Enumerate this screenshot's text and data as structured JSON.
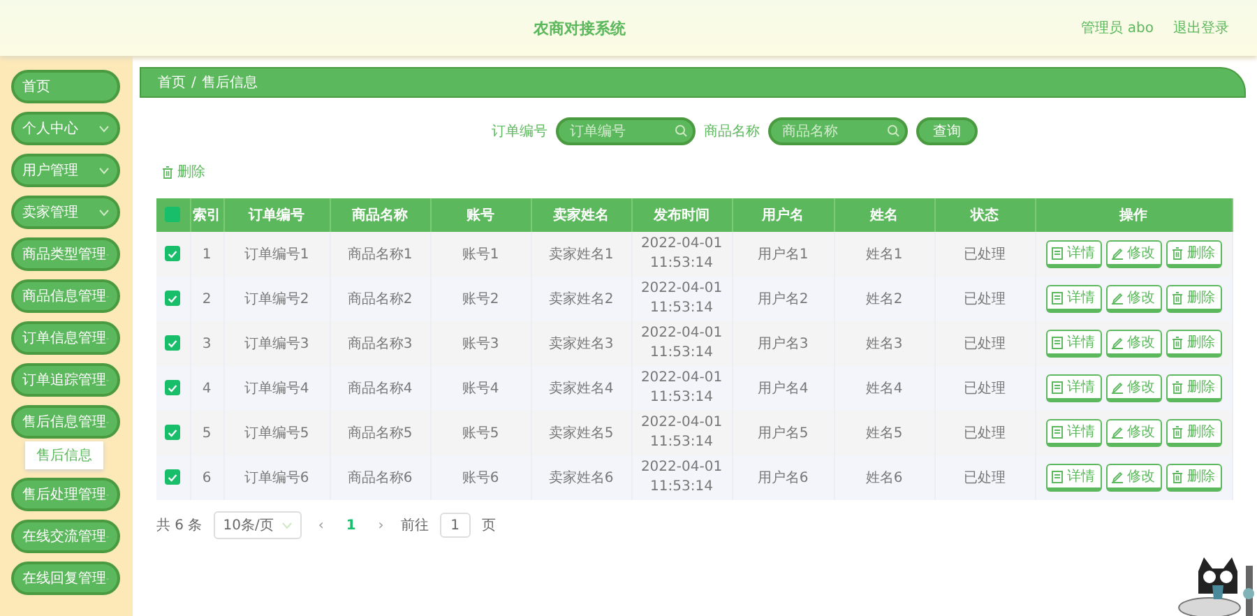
{
  "header": {
    "title": "农商对接系统",
    "user": "管理员 abo",
    "logout": "退出登录"
  },
  "sidebar": {
    "items": [
      {
        "label": "首页",
        "expandable": false
      },
      {
        "label": "个人中心",
        "expandable": true,
        "expanded": false
      },
      {
        "label": "用户管理",
        "expandable": true,
        "expanded": false
      },
      {
        "label": "卖家管理",
        "expandable": true,
        "expanded": false
      },
      {
        "label": "商品类型管理",
        "expandable": true,
        "expanded": false
      },
      {
        "label": "商品信息管理",
        "expandable": true,
        "expanded": false
      },
      {
        "label": "订单信息管理",
        "expandable": true,
        "expanded": false
      },
      {
        "label": "订单追踪管理",
        "expandable": true,
        "expanded": false
      },
      {
        "label": "售后信息管理",
        "expandable": true,
        "expanded": true,
        "children": [
          {
            "label": "售后信息"
          }
        ]
      },
      {
        "label": "售后处理管理",
        "expandable": true,
        "expanded": false
      },
      {
        "label": "在线交流管理",
        "expandable": true,
        "expanded": false
      },
      {
        "label": "在线回复管理",
        "expandable": true,
        "expanded": false
      }
    ]
  },
  "breadcrumb": [
    "首页",
    "/",
    "售后信息"
  ],
  "search": {
    "fields": [
      {
        "label": "订单编号",
        "placeholder": "订单编号"
      },
      {
        "label": "商品名称",
        "placeholder": "商品名称"
      }
    ],
    "button": "查询"
  },
  "toolbar": {
    "delete": "删除"
  },
  "table": {
    "select_all_checked": true,
    "columns": [
      "索引",
      "订单编号",
      "商品名称",
      "账号",
      "卖家姓名",
      "发布时间",
      "用户名",
      "姓名",
      "状态",
      "操作"
    ],
    "rows": [
      {
        "checked": true,
        "cells": [
          "1",
          "订单编号1",
          "商品名称1",
          "账号1",
          "卖家姓名1",
          "2022-04-01 11:53:14",
          "用户名1",
          "姓名1",
          "已处理"
        ],
        "actions": [
          {
            "kind": "detail",
            "label": "详情"
          },
          {
            "kind": "edit",
            "label": "修改"
          },
          {
            "kind": "delete",
            "label": "删除"
          }
        ]
      },
      {
        "checked": true,
        "cells": [
          "2",
          "订单编号2",
          "商品名称2",
          "账号2",
          "卖家姓名2",
          "2022-04-01 11:53:14",
          "用户名2",
          "姓名2",
          "已处理"
        ],
        "actions": [
          {
            "kind": "detail",
            "label": "详情"
          },
          {
            "kind": "edit",
            "label": "修改"
          },
          {
            "kind": "delete",
            "label": "删除"
          }
        ]
      },
      {
        "checked": true,
        "cells": [
          "3",
          "订单编号3",
          "商品名称3",
          "账号3",
          "卖家姓名3",
          "2022-04-01 11:53:14",
          "用户名3",
          "姓名3",
          "已处理"
        ],
        "actions": [
          {
            "kind": "detail",
            "label": "详情"
          },
          {
            "kind": "edit",
            "label": "修改"
          },
          {
            "kind": "delete",
            "label": "删除"
          }
        ]
      },
      {
        "checked": true,
        "cells": [
          "4",
          "订单编号4",
          "商品名称4",
          "账号4",
          "卖家姓名4",
          "2022-04-01 11:53:14",
          "用户名4",
          "姓名4",
          "已处理"
        ],
        "actions": [
          {
            "kind": "detail",
            "label": "详情"
          },
          {
            "kind": "edit",
            "label": "修改"
          },
          {
            "kind": "delete",
            "label": "删除"
          }
        ]
      },
      {
        "checked": true,
        "cells": [
          "5",
          "订单编号5",
          "商品名称5",
          "账号5",
          "卖家姓名5",
          "2022-04-01 11:53:14",
          "用户名5",
          "姓名5",
          "已处理"
        ],
        "actions": [
          {
            "kind": "detail",
            "label": "详情"
          },
          {
            "kind": "edit",
            "label": "修改"
          },
          {
            "kind": "delete",
            "label": "删除"
          }
        ]
      },
      {
        "checked": true,
        "cells": [
          "6",
          "订单编号6",
          "商品名称6",
          "账号6",
          "卖家姓名6",
          "2022-04-01 11:53:14",
          "用户名6",
          "姓名6",
          "已处理"
        ],
        "actions": [
          {
            "kind": "detail",
            "label": "详情"
          },
          {
            "kind": "edit",
            "label": "修改"
          },
          {
            "kind": "delete",
            "label": "删除"
          }
        ]
      }
    ]
  },
  "pagination": {
    "total": "共 6 条",
    "page_size": "10条/页",
    "prev": "‹",
    "pages": [
      {
        "label": "1",
        "selected": true
      }
    ],
    "next": "›",
    "goto": "前往",
    "goto_value": "1",
    "unit": "页"
  }
}
